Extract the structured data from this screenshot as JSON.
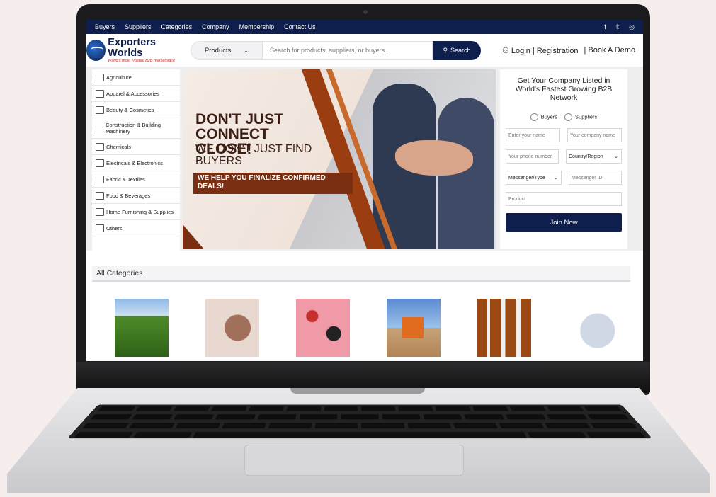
{
  "topnav": {
    "items": [
      "Buyers",
      "Suppliers",
      "Categories",
      "Company",
      "Membership",
      "Contact Us"
    ],
    "social": [
      "f",
      "𝕥",
      "◎"
    ]
  },
  "brand": {
    "name": "Exporters Worlds",
    "tagline": "World's most Trusted B2B marketplace"
  },
  "search": {
    "category": "Products",
    "placeholder": "Search for products, suppliers, or buyers...",
    "button": "Search"
  },
  "auth": {
    "login": "Login | Registration",
    "demo": "| Book A Demo"
  },
  "categories": [
    "Agriculture",
    "Apparel & Accessories",
    "Beauty & Cosmetics",
    "Construction & Building Machinery",
    "Chemicals",
    "Electricals & Electronics",
    "Fabric & Textiles",
    "Food & Beverages",
    "Home Furnishing & Supplies",
    "Others"
  ],
  "banner": {
    "line1": "DON'T JUST CONNECT",
    "line2": "CLOSE!",
    "line3": "WE DON'T JUST FIND",
    "line4": "BUYERS",
    "strip": "WE HELP YOU FINALIZE CONFIRMED DEALS!"
  },
  "form": {
    "title": "Get Your Company Listed in World's Fastest Growing B2B Network",
    "radio_buyers": "Buyers",
    "radio_suppliers": "Suppliers",
    "name": "Enter your name",
    "company": "Your company name",
    "phone": "Your phone number",
    "country": "Country/Region",
    "messenger_type": "Messenger/Type",
    "messenger_id": "Messenger ID",
    "product": "Product",
    "join": "Join Now"
  },
  "all_categories": "All Categories"
}
